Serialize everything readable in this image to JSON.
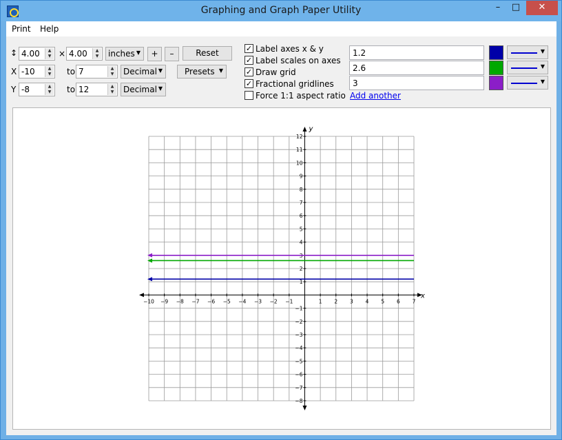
{
  "window": {
    "title": "Graphing and Graph Paper Utility",
    "minimize": "–",
    "maximize": "□",
    "close": "✕"
  },
  "menu": {
    "print": "Print",
    "help": "Help"
  },
  "size": {
    "height_symbol": "↕",
    "width": "4.00",
    "times": "×",
    "height": "4.00",
    "units": "inches",
    "plus": "+",
    "minus": "–",
    "reset": "Reset"
  },
  "x_range": {
    "label": "X",
    "from": "-10",
    "to_label": "to",
    "to": "7",
    "format": "Decimal"
  },
  "y_range": {
    "label": "Y",
    "from": "-8",
    "to_label": "to",
    "to": "12",
    "format": "Decimal"
  },
  "presets": "Presets",
  "options": [
    {
      "label": "Label axes x & y",
      "checked": true
    },
    {
      "label": "Label scales on axes",
      "checked": true
    },
    {
      "label": "Draw grid",
      "checked": true
    },
    {
      "label": "Fractional gridlines",
      "checked": true
    },
    {
      "label": "Force 1:1 aspect ratio",
      "checked": false
    }
  ],
  "functions": [
    {
      "expr": "1.2",
      "color": "#0000a8"
    },
    {
      "expr": "2.6",
      "color": "#00a800"
    },
    {
      "expr": "3",
      "color": "#8b1ec8"
    }
  ],
  "add_another": "Add another",
  "graph": {
    "x_label": "x",
    "y_label": "y",
    "x_ticks": [
      "−10",
      "−9",
      "−8",
      "−7",
      "−6",
      "−5",
      "−4",
      "−3",
      "−2",
      "−1",
      "1",
      "2",
      "3",
      "4",
      "5",
      "6",
      "7"
    ],
    "y_ticks": [
      "12",
      "11",
      "10",
      "9",
      "8",
      "7",
      "6",
      "5",
      "4",
      "3",
      "2",
      "1",
      "−1",
      "−2",
      "−3",
      "−4",
      "−5",
      "−6",
      "−7",
      "−8"
    ]
  },
  "chart_data": {
    "type": "line",
    "xlim": [
      -10,
      7
    ],
    "ylim": [
      -8,
      12
    ],
    "xlabel": "x",
    "ylabel": "y",
    "grid": true,
    "series": [
      {
        "name": "1.2",
        "x": [
          -10,
          7
        ],
        "y": [
          1.2,
          1.2
        ],
        "color": "#0000a8"
      },
      {
        "name": "2.6",
        "x": [
          -10,
          7
        ],
        "y": [
          2.6,
          2.6
        ],
        "color": "#00a800"
      },
      {
        "name": "3",
        "x": [
          -10,
          7
        ],
        "y": [
          3,
          3
        ],
        "color": "#8b1ec8"
      }
    ]
  }
}
